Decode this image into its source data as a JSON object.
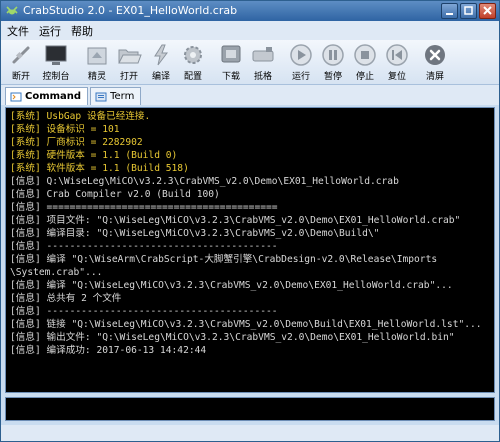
{
  "window": {
    "title": "CrabStudio 2.0 - EX01_HelloWorld.crab",
    "controls": [
      "minimize-icon",
      "maximize-icon",
      "close-icon"
    ]
  },
  "menu": [
    "文件",
    "运行",
    "帮助"
  ],
  "toolbar": [
    {
      "label": "断开",
      "icon": "disconnect-icon"
    },
    {
      "label": "控制台",
      "icon": "console-icon"
    },
    {
      "label": "精灵",
      "icon": "wizard-icon"
    },
    {
      "label": "打开",
      "icon": "open-folder-icon"
    },
    {
      "label": "编译",
      "icon": "compile-icon"
    },
    {
      "label": "配置",
      "icon": "gear-icon"
    },
    {
      "label": "下载",
      "icon": "download-icon"
    },
    {
      "label": "抵格",
      "icon": "format-icon"
    },
    {
      "label": "运行",
      "icon": "play-icon"
    },
    {
      "label": "暂停",
      "icon": "pause-icon"
    },
    {
      "label": "停止",
      "icon": "stop-icon"
    },
    {
      "label": "复位",
      "icon": "reset-icon"
    },
    {
      "label": "清屏",
      "icon": "clear-icon"
    }
  ],
  "tabs": [
    {
      "label": "Command",
      "icon": "command-icon",
      "active": true
    },
    {
      "label": "Term",
      "icon": "terminal-icon",
      "active": false
    }
  ],
  "console": {
    "lines": [
      {
        "type": "sys",
        "text": "[系统] UsbGap 设备已经连接."
      },
      {
        "type": "sys",
        "text": "[系统] 设备标识 = 101"
      },
      {
        "type": "sys",
        "text": "[系统] 厂商标识 = 2282902"
      },
      {
        "type": "sys",
        "text": "[系统] 硬件版本 = 1.1 (Build 0)"
      },
      {
        "type": "sys",
        "text": "[系统] 软件版本 = 1.1 (Build 518)"
      },
      {
        "type": "info",
        "text": "[信息] Q:\\WiseLeg\\MiCO\\v3.2.3\\CrabVMS_v2.0\\Demo\\EX01_HelloWorld.crab"
      },
      {
        "type": "info",
        "text": "[信息] Crab Compiler v2.0 (Build 100)"
      },
      {
        "type": "info",
        "text": "[信息] ========================================"
      },
      {
        "type": "info",
        "text": "[信息] 项目文件: \"Q:\\WiseLeg\\MiCO\\v3.2.3\\CrabVMS_v2.0\\Demo\\EX01_HelloWorld.crab\""
      },
      {
        "type": "info",
        "text": "[信息] 编译目录: \"Q:\\WiseLeg\\MiCO\\v3.2.3\\CrabVMS_v2.0\\Demo\\Build\\\""
      },
      {
        "type": "info",
        "text": "[信息] ----------------------------------------"
      },
      {
        "type": "info",
        "text": "[信息] 编译 \"Q:\\WiseArm\\CrabScript-大脚蟹引擎\\CrabDesign-v2.0\\Release\\Imports"
      },
      {
        "type": "info",
        "text": "\\System.crab\"..."
      },
      {
        "type": "info",
        "text": "[信息] 编译 \"Q:\\WiseLeg\\MiCO\\v3.2.3\\CrabVMS_v2.0\\Demo\\EX01_HelloWorld.crab\"..."
      },
      {
        "type": "info",
        "text": "[信息] 总共有 2 个文件"
      },
      {
        "type": "info",
        "text": "[信息] ----------------------------------------"
      },
      {
        "type": "info",
        "text": "[信息] 链接 \"Q:\\WiseLeg\\MiCO\\v3.2.3\\CrabVMS_v2.0\\Demo\\Build\\EX01_HelloWorld.lst\"..."
      },
      {
        "type": "info",
        "text": "[信息] 输出文件: \"Q:\\WiseLeg\\MiCO\\v3.2.3\\CrabVMS_v2.0\\Demo\\EX01_HelloWorld.bin\""
      },
      {
        "type": "info",
        "text": "[信息] 编译成功: 2017-06-13 14:42:44"
      }
    ]
  },
  "colors": {
    "titlebar": "#2f64a3",
    "console_bg": "#000000",
    "system_text": "#e8c833",
    "info_text": "#d8d8d8"
  }
}
